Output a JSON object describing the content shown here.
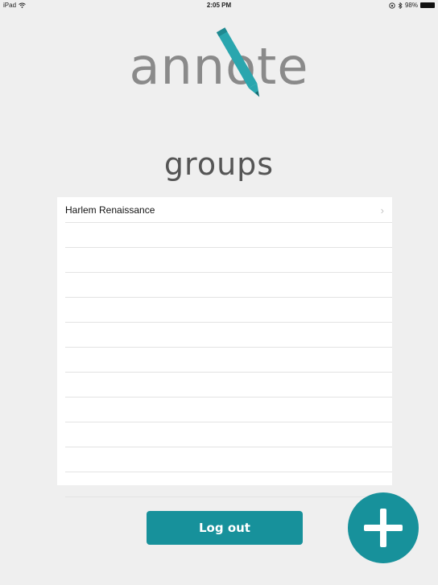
{
  "status_bar": {
    "device": "iPad",
    "time": "2:05 PM",
    "battery_text": "98%",
    "battery_level": 0.98
  },
  "logo": {
    "text": "annote",
    "accent_color": "#2aa6ae",
    "text_color": "#8a8a8a"
  },
  "page": {
    "title": "groups"
  },
  "groups": [
    {
      "label": "Harlem Renaissance"
    },
    {
      "label": ""
    },
    {
      "label": ""
    },
    {
      "label": ""
    },
    {
      "label": ""
    },
    {
      "label": ""
    },
    {
      "label": ""
    },
    {
      "label": ""
    },
    {
      "label": ""
    },
    {
      "label": ""
    },
    {
      "label": ""
    },
    {
      "label": ""
    }
  ],
  "actions": {
    "logout_label": "Log out",
    "add_icon": "plus-icon",
    "primary_color": "#17919b"
  }
}
